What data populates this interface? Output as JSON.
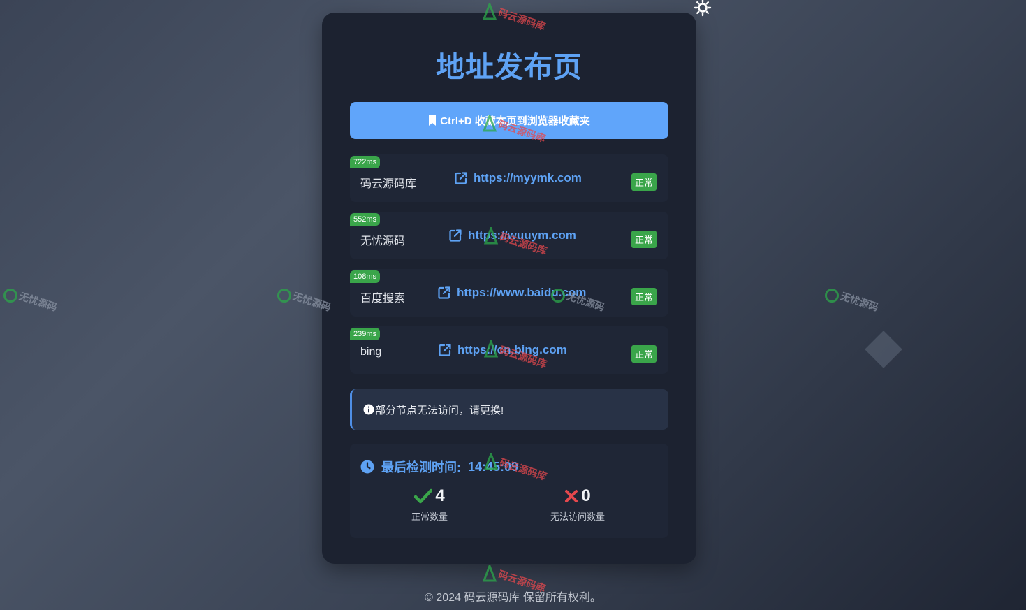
{
  "theme_toggle": {
    "icon": "sun-icon"
  },
  "card": {
    "title": "地址发布页",
    "bookmark_button": {
      "icon": "bookmark-icon",
      "label": "Ctrl+D 收藏本页到浏览器收藏夹"
    },
    "links": [
      {
        "latency": "722ms",
        "name": "码云源码库",
        "url": "https://myymk.com",
        "status": "正常"
      },
      {
        "latency": "552ms",
        "name": "无忧源码",
        "url": "https://wuuym.com",
        "status": "正常"
      },
      {
        "latency": "108ms",
        "name": "百度搜索",
        "url": "https://www.baidu.com",
        "status": "正常"
      },
      {
        "latency": "239ms",
        "name": "bing",
        "url": "https://cn.bing.com",
        "status": "正常"
      }
    ],
    "notice": {
      "icon": "info-icon",
      "text": "部分节点无法访问，请更换!"
    },
    "stats": {
      "check_time_label": "最后检测时间:",
      "check_time_value": "14:45:09",
      "ok": {
        "icon": "check-icon",
        "value": "4",
        "label": "正常数量"
      },
      "fail": {
        "icon": "cross-icon",
        "value": "0",
        "label": "无法访问数量"
      }
    }
  },
  "footer": {
    "text": "© 2024 码云源码库 保留所有权利。"
  },
  "watermarks": {
    "red": "码云源码库",
    "gray": "无忧源码"
  },
  "colors": {
    "accent": "#5ea2f4",
    "button": "#60a5fa",
    "success": "#3aa54a",
    "danger": "#e5484d",
    "card": "#1c2230"
  }
}
